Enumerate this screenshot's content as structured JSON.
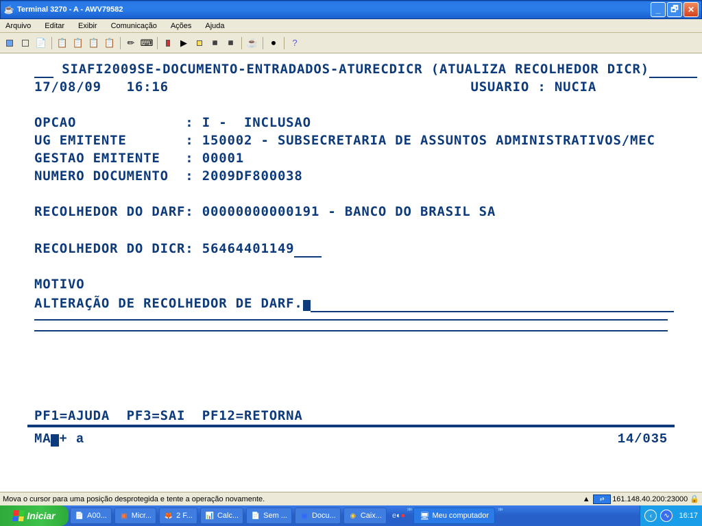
{
  "window": {
    "title": "Terminal 3270 - A - AWV79582"
  },
  "menu": {
    "arquivo": "Arquivo",
    "editar": "Editar",
    "exibir": "Exibir",
    "comunicacao": "Comunicação",
    "acoes": "Ações",
    "ajuda": "Ajuda"
  },
  "screen": {
    "header_path": "SIAFI2009SE-DOCUMENTO-ENTRADADOS-ATURECDICR",
    "header_desc": "(ATUALIZA RECOLHEDOR DICR)",
    "date": "17/08/09",
    "time": "16:16",
    "usuario_label": "USUARIO :",
    "usuario": "NUCIA",
    "fields": {
      "opcao_label": "OPCAO",
      "opcao": "I -  INCLUSAO",
      "ugemit_label": "UG EMITENTE",
      "ugemit": "150002 - SUBSECRETARIA DE ASSUNTOS ADMINISTRATIVOS/MEC",
      "gestao_label": "GESTAO EMITENTE",
      "gestao": "00001",
      "numdoc_label": "NUMERO DOCUMENTO",
      "numdoc": "2009DF800038",
      "recdarf_label": "RECOLHEDOR DO DARF:",
      "recdarf": "00000000000191 - BANCO DO BRASIL SA",
      "recdicr_label": "RECOLHEDOR DO DICR:",
      "recdicr": "56464401149",
      "motivo_label": "MOTIVO",
      "motivo_text": "ALTERAÇÃO DE RECOLHEDOR DE DARF."
    },
    "fkeys": "PF1=AJUDA  PF3=SAI  PF12=RETORNA",
    "status_left": "MA",
    "status_a": "a",
    "status_pos": "14/035"
  },
  "winstat": {
    "msg": "Mova o cursor para uma posição desprotegida e tente a operação novamente.",
    "host": "161.148.40.200:23000"
  },
  "taskbar": {
    "start": "Iniciar",
    "items": [
      {
        "label": "A00..."
      },
      {
        "label": "Micr..."
      },
      {
        "label": "2 F..."
      },
      {
        "label": "Calc..."
      },
      {
        "label": "Sem ..."
      },
      {
        "label": "Docu..."
      },
      {
        "label": "Caix..."
      }
    ],
    "mycomputer": "Meu computador",
    "clock": "16:17"
  }
}
